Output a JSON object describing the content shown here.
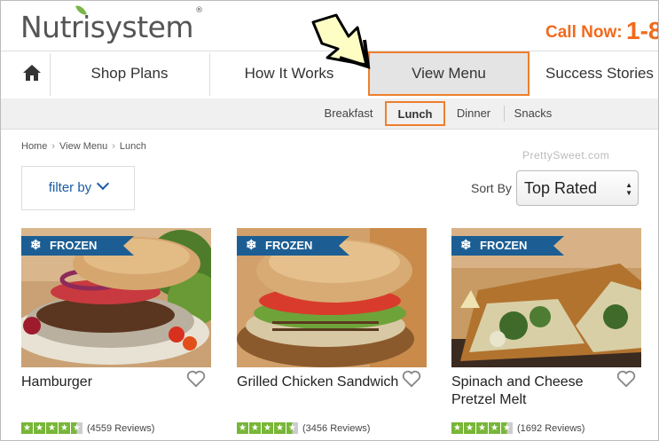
{
  "header": {
    "logo_text": "Nutrisystem",
    "trademark": "®",
    "call_label": "Call Now:",
    "call_number": "1-8"
  },
  "nav": {
    "items": [
      {
        "label": "Shop Plans"
      },
      {
        "label": "How It Works"
      },
      {
        "label": "View Menu"
      },
      {
        "label": "Success Stories"
      }
    ]
  },
  "subnav": {
    "items": [
      {
        "label": "Breakfast"
      },
      {
        "label": "Lunch"
      },
      {
        "label": "Dinner"
      },
      {
        "label": "Snacks"
      }
    ]
  },
  "breadcrumb": [
    "Home",
    "View Menu",
    "Lunch"
  ],
  "watermark": "PrettySweet.com",
  "filter": {
    "label": "filter by"
  },
  "sort": {
    "label": "Sort By",
    "selected": "Top Rated"
  },
  "products": [
    {
      "badge": "FROZEN",
      "name": "Hamburger",
      "rating": 4.5,
      "reviews": "(4559 Reviews)"
    },
    {
      "badge": "FROZEN",
      "name": "Grilled Chicken Sandwich",
      "rating": 4.5,
      "reviews": "(3456 Reviews)"
    },
    {
      "badge": "FROZEN",
      "name": "Spinach and Cheese Pretzel Melt",
      "rating": 4.5,
      "reviews": "(1692 Reviews)"
    }
  ],
  "colors": {
    "accent": "#ee7f2d",
    "brand_orange": "#f26a1b",
    "badge_blue": "#1c5e93",
    "star_green": "#78b637",
    "link_blue": "#1a5ba8"
  }
}
